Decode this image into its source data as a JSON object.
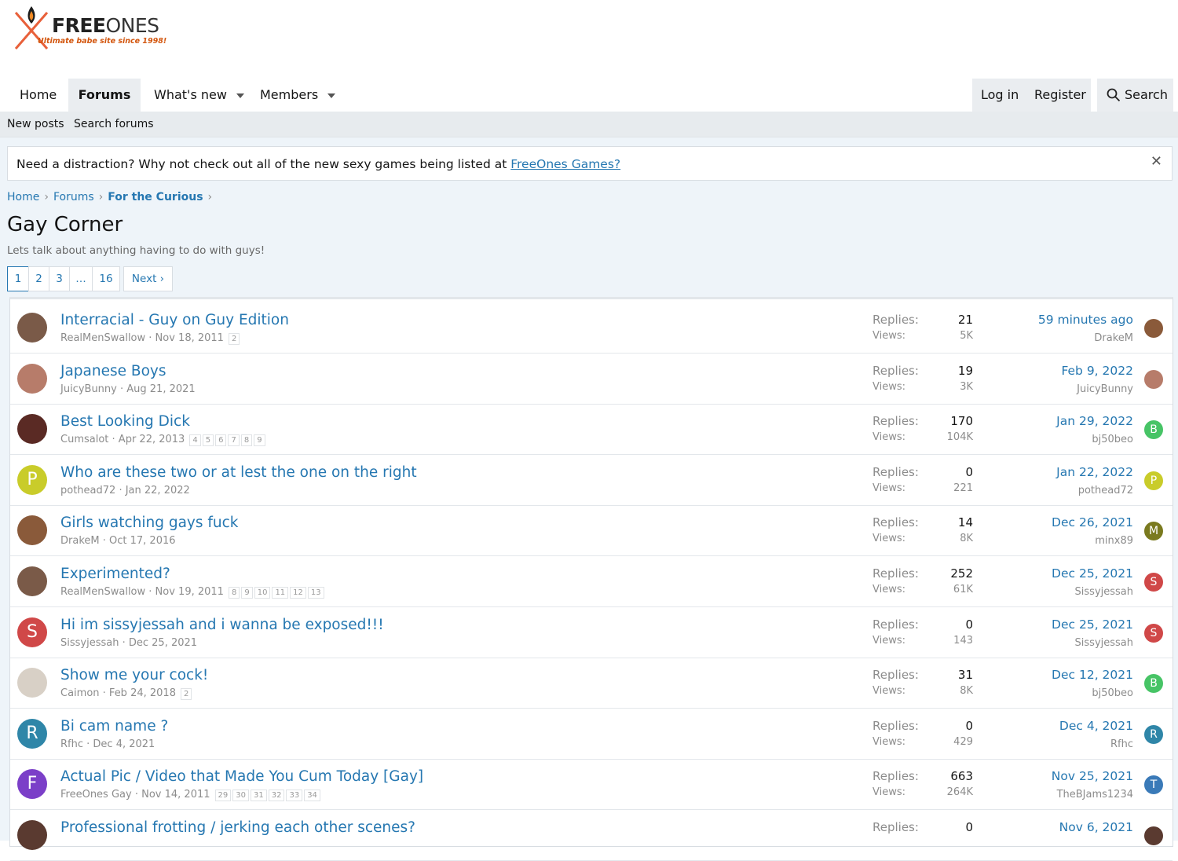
{
  "brand": {
    "name_bold": "FREE",
    "name_light": "ONES",
    "tagline": "Ultimate babe site since 1998!"
  },
  "nav": {
    "home": "Home",
    "forums": "Forums",
    "whats_new": "What's new",
    "members": "Members",
    "login": "Log in",
    "register": "Register",
    "search": "Search"
  },
  "subnav": {
    "new_posts": "New posts",
    "search_forums": "Search forums"
  },
  "notice": {
    "text": "Need a distraction? Why not check out all of the new sexy games being listed at ",
    "link": "FreeOnes Games?",
    "close": "✕"
  },
  "breadcrumb": {
    "home": "Home",
    "forums": "Forums",
    "category": "For the Curious",
    "sep": "›"
  },
  "forum": {
    "title": "Gay Corner",
    "description": "Lets talk about anything having to do with guys!"
  },
  "pagination": {
    "p1": "1",
    "p2": "2",
    "p3": "3",
    "ellipsis": "…",
    "last": "16",
    "next": "Next ›"
  },
  "labels": {
    "replies": "Replies:",
    "views": "Views:"
  },
  "threads": [
    {
      "title": "Interracial - Guy on Guy Edition",
      "author": "RealMenSwallow",
      "date": "Nov 18, 2011",
      "pages": "2",
      "replies": "21",
      "views": "5K",
      "last_date": "59 minutes ago",
      "last_user": "DrakeM",
      "avatar_letter": "",
      "avatar_color": "#7a5a48",
      "last_letter": "",
      "last_color": "#8a5a3a"
    },
    {
      "title": "Japanese Boys",
      "author": "JuicyBunny",
      "date": "Aug 21, 2021",
      "pages": "",
      "replies": "19",
      "views": "3K",
      "last_date": "Feb 9, 2022",
      "last_user": "JuicyBunny",
      "avatar_letter": "",
      "avatar_color": "#b77c6a",
      "last_letter": "",
      "last_color": "#b77c6a"
    },
    {
      "title": "Best Looking Dick",
      "author": "Cumsalot",
      "date": "Apr 22, 2013",
      "pages": "4 5 6 7 8 9",
      "replies": "170",
      "views": "104K",
      "last_date": "Jan 29, 2022",
      "last_user": "bj50beo",
      "avatar_letter": "",
      "avatar_color": "#5a2a24",
      "last_letter": "B",
      "last_color": "#47c466"
    },
    {
      "title": "Who are these two or at lest the one on the right",
      "author": "pothead72",
      "date": "Jan 22, 2022",
      "pages": "",
      "replies": "0",
      "views": "221",
      "last_date": "Jan 22, 2022",
      "last_user": "pothead72",
      "avatar_letter": "P",
      "avatar_color": "#c9cc2a",
      "last_letter": "P",
      "last_color": "#c9cc2a"
    },
    {
      "title": "Girls watching gays fuck",
      "author": "DrakeM",
      "date": "Oct 17, 2016",
      "pages": "",
      "replies": "14",
      "views": "8K",
      "last_date": "Dec 26, 2021",
      "last_user": "minx89",
      "avatar_letter": "",
      "avatar_color": "#8a5a3a",
      "last_letter": "M",
      "last_color": "#7a7a1f"
    },
    {
      "title": "Experimented?",
      "author": "RealMenSwallow",
      "date": "Nov 19, 2011",
      "pages": "8 9 10 11 12 13",
      "replies": "252",
      "views": "61K",
      "last_date": "Dec 25, 2021",
      "last_user": "Sissyjessah",
      "avatar_letter": "",
      "avatar_color": "#7a5a48",
      "last_letter": "S",
      "last_color": "#d04848"
    },
    {
      "title": "Hi im sissyjessah and i wanna be exposed!!!",
      "author": "Sissyjessah",
      "date": "Dec 25, 2021",
      "pages": "",
      "replies": "0",
      "views": "143",
      "last_date": "Dec 25, 2021",
      "last_user": "Sissyjessah",
      "avatar_letter": "S",
      "avatar_color": "#d04848",
      "last_letter": "S",
      "last_color": "#d04848"
    },
    {
      "title": "Show me your cock!",
      "author": "Caimon",
      "date": "Feb 24, 2018",
      "pages": "2",
      "replies": "31",
      "views": "8K",
      "last_date": "Dec 12, 2021",
      "last_user": "bj50beo",
      "avatar_letter": "",
      "avatar_color": "#d8d0c6",
      "last_letter": "B",
      "last_color": "#47c466"
    },
    {
      "title": "Bi cam name ?",
      "author": "Rfhc",
      "date": "Dec 4, 2021",
      "pages": "",
      "replies": "0",
      "views": "429",
      "last_date": "Dec 4, 2021",
      "last_user": "Rfhc",
      "avatar_letter": "R",
      "avatar_color": "#2f86a8",
      "last_letter": "R",
      "last_color": "#2f86a8"
    },
    {
      "title": "Actual Pic / Video that Made You Cum Today [Gay]",
      "author": "FreeOnes Gay",
      "date": "Nov 14, 2011",
      "pages": "29 30 31 32 33 34",
      "replies": "663",
      "views": "264K",
      "last_date": "Nov 25, 2021",
      "last_user": "TheBJams1234",
      "avatar_letter": "F",
      "avatar_color": "#7b3fc8",
      "last_letter": "T",
      "last_color": "#3a7ab8"
    },
    {
      "title": "Professional frotting / jerking each other scenes?",
      "author": "",
      "date": "",
      "pages": "",
      "replies": "0",
      "views": "",
      "last_date": "Nov 6, 2021",
      "last_user": "",
      "avatar_letter": "",
      "avatar_color": "#5a3a30",
      "last_letter": "",
      "last_color": "#5a3a30"
    }
  ],
  "colors": {
    "link": "#2577b1",
    "muted": "#8c8c8c",
    "tab_bg": "#eaedf0",
    "page_bg": "#eef4f9"
  }
}
